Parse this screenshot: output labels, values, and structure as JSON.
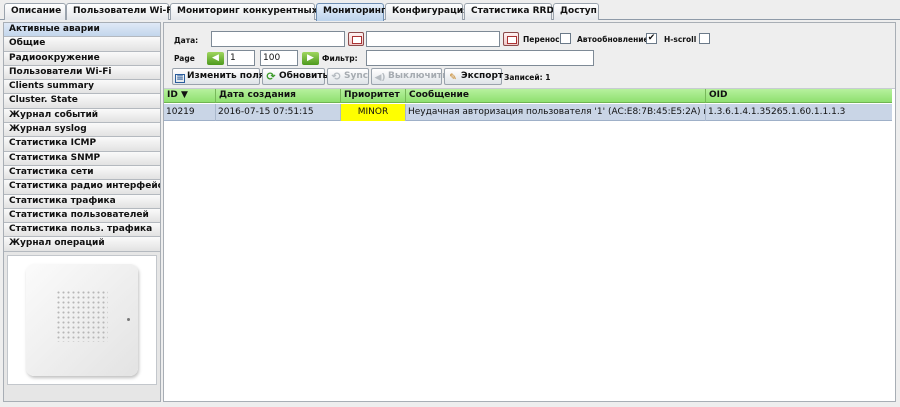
{
  "tabs": [
    {
      "label": "Описание",
      "active": false
    },
    {
      "label": "Пользователи Wi-Fi",
      "active": false
    },
    {
      "label": "Мониторинг конкурентных ТД",
      "active": false
    },
    {
      "label": "Мониторинг",
      "active": true
    },
    {
      "label": "Конфигурация",
      "active": false
    },
    {
      "label": "Статистика RRD",
      "active": false
    },
    {
      "label": "Доступ",
      "active": false
    }
  ],
  "sidebar": {
    "items": [
      "Активные аварии",
      "Общие",
      "Радиоокружение",
      "Пользователи Wi-Fi",
      "Clients summary",
      "Cluster. State",
      "Журнал событий",
      "Журнал syslog",
      "Статистика ICMP",
      "Статистика SNMP",
      "Статистика сети",
      "Статистика радио интерфейсов",
      "Статистика трафика",
      "Статистика пользователей",
      "Статистика польз. трафика",
      "Журнал операций"
    ],
    "active_index": 0
  },
  "filters": {
    "date_label": "Дата:",
    "date_from": "",
    "date_to": "",
    "wrap_label": "Перенос",
    "wrap_checked": false,
    "autorefresh_label": "Автообновление",
    "autorefresh_checked": true,
    "hscroll_label": "H-scroll",
    "hscroll_checked": false,
    "page_label": "Page",
    "page_value": "1",
    "page_size": "100",
    "filter_label": "Фильтр:",
    "filter_value": ""
  },
  "toolbar": {
    "edit_fields": "Изменить поля",
    "refresh": "Обновить",
    "sync": "Sync",
    "mute": "Выключить",
    "export": "Экспорт",
    "records": "Записей: 1"
  },
  "table": {
    "columns": [
      "ID ▼",
      "Дата создания",
      "Приоритет",
      "Сообщение",
      "OID"
    ],
    "rows": [
      {
        "id": "10219",
        "created": "2016-07-15 07:51:15",
        "priority": "MINOR",
        "message": "Неудачная авторизация пользователя '1' (AC:E8:7B:45:E5:2A) на wl...",
        "oid": "1.3.6.1.4.1.35265.1.60.1.1.1.3"
      }
    ]
  },
  "colors": {
    "header_green": "#8fe070",
    "row_selected": "#c9d5e6",
    "priority_minor": "#ffff00",
    "active_tab": "#bcd3ec"
  }
}
